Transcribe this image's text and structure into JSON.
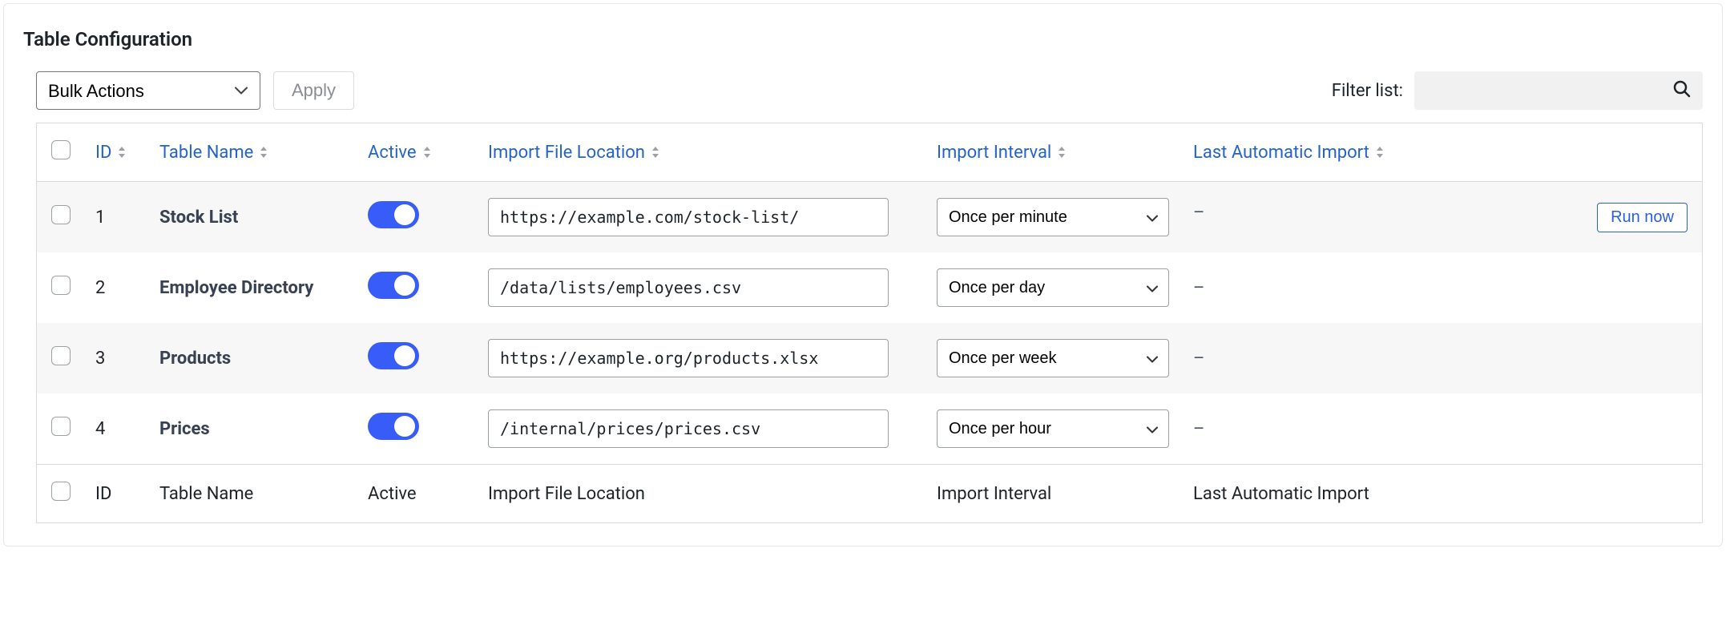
{
  "panel": {
    "title": "Table Configuration"
  },
  "toolbar": {
    "bulk_selected": "Bulk Actions",
    "apply_label": "Apply",
    "filter_label": "Filter list:",
    "filter_value": ""
  },
  "columns": {
    "id": "ID",
    "table_name": "Table Name",
    "active": "Active",
    "location": "Import File Location",
    "interval": "Import Interval",
    "last_import": "Last Automatic Import"
  },
  "rows": [
    {
      "id": "1",
      "name": "Stock List",
      "active": true,
      "location": "https://example.com/stock-list/",
      "interval": "Once per minute",
      "last_import": "–",
      "run_now_label": "Run now",
      "show_run_now": true
    },
    {
      "id": "2",
      "name": "Employee Directory",
      "active": true,
      "location": "/data/lists/employees.csv",
      "interval": "Once per day",
      "last_import": "–",
      "show_run_now": false
    },
    {
      "id": "3",
      "name": "Products",
      "active": true,
      "location": "https://example.org/products.xlsx",
      "interval": "Once per week",
      "last_import": "–",
      "show_run_now": false
    },
    {
      "id": "4",
      "name": "Prices",
      "active": true,
      "location": "/internal/prices/prices.csv",
      "interval": "Once per hour",
      "last_import": "–",
      "show_run_now": false
    }
  ]
}
